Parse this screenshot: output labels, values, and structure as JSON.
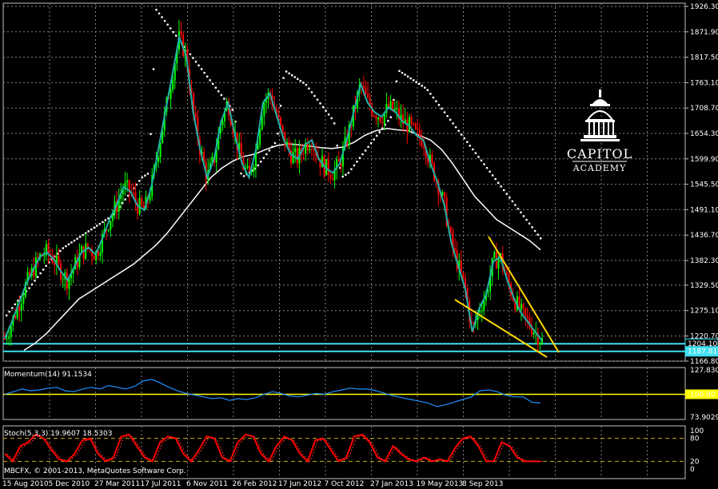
{
  "chart_data": [
    {
      "type": "candlestick",
      "panel": "price",
      "ylim": [
        1166.8,
        1926.3
      ],
      "y_ticks": [
        "1926.30",
        "1871.90",
        "1817.50",
        "1763.10",
        "1708.70",
        "1654.30",
        "1599.90",
        "1545.50",
        "1491.10",
        "1436.70",
        "1382.30",
        "1329.50",
        "1275.10",
        "1220.70",
        "1166.80"
      ],
      "x_ticks": [
        "15 Aug 2010",
        "5 Dec 2010",
        "27 Mar 2011",
        "17 Jul 2011",
        "6 Nov 2011",
        "26 Feb 2012",
        "17 Jun 2012",
        "7 Oct 2012",
        "27 Jan 2013",
        "19 May 2013",
        "8 Sep 2013"
      ],
      "price_series": [
        1215,
        1250,
        1290,
        1330,
        1360,
        1390,
        1400,
        1385,
        1360,
        1340,
        1370,
        1400,
        1410,
        1395,
        1430,
        1470,
        1500,
        1540,
        1530,
        1500,
        1490,
        1540,
        1620,
        1700,
        1780,
        1860,
        1820,
        1700,
        1620,
        1560,
        1600,
        1680,
        1720,
        1650,
        1590,
        1560,
        1620,
        1720,
        1740,
        1690,
        1640,
        1610,
        1600,
        1630,
        1640,
        1600,
        1580,
        1570,
        1590,
        1640,
        1700,
        1760,
        1720,
        1700,
        1690,
        1710,
        1700,
        1680,
        1670,
        1650,
        1640,
        1590,
        1550,
        1500,
        1420,
        1370,
        1320,
        1230,
        1280,
        1310,
        1380,
        1390,
        1340,
        1300,
        1270,
        1250,
        1230,
        1210
      ],
      "moving_average_long": [
        1190,
        1205,
        1225,
        1250,
        1275,
        1300,
        1315,
        1330,
        1345,
        1360,
        1375,
        1395,
        1415,
        1440,
        1470,
        1500,
        1530,
        1560,
        1580,
        1595,
        1605,
        1610,
        1620,
        1628,
        1632,
        1630,
        1627,
        1624,
        1622,
        1625,
        1635,
        1650,
        1660,
        1665,
        1662,
        1660,
        1650,
        1640,
        1620,
        1590,
        1555,
        1520,
        1495,
        1470,
        1455,
        1440,
        1425,
        1405
      ],
      "sar": [
        1265,
        1285,
        1305,
        1320,
        1340,
        1360,
        1380,
        1395,
        1410,
        1420,
        1430,
        1440,
        1450,
        1460,
        1470,
        1480,
        1500,
        1520,
        1540,
        1560,
        1570,
        1920,
        1900,
        1880,
        1860,
        1840,
        1820,
        1800,
        1780,
        1760,
        1740,
        1720,
        1700,
        1560,
        1570,
        1580,
        1600,
        1620,
        1640,
        1790,
        1780,
        1770,
        1760,
        1740,
        1720,
        1700,
        1680,
        1560,
        1570,
        1590,
        1610,
        1630,
        1650,
        1670,
        1690,
        1790,
        1780,
        1770,
        1760,
        1750,
        1730,
        1710,
        1690,
        1670,
        1650,
        1630,
        1610,
        1590,
        1570,
        1550,
        1530,
        1510,
        1490,
        1470,
        1450,
        1430
      ],
      "horizontal_lines": [
        1204.1,
        1187.81
      ],
      "price_labels": [
        "1204.10",
        "1187.81"
      ],
      "colors": {
        "bull": "#00ff00",
        "bear": "#ff0000",
        "ma_short": "#20b2aa",
        "ma_long": "#ffffff",
        "sar": "#ffffff",
        "hline": "#40e0f0",
        "trendline": "#ffd700",
        "grid": "#808080"
      }
    },
    {
      "type": "line",
      "panel": "momentum",
      "label": "Momentum(14) 91.1534",
      "ylim": [
        73.9029,
        127.8301
      ],
      "y_ticks": [
        "127.8301",
        "100.00",
        "73.9029"
      ],
      "level": 100.0,
      "values": [
        100,
        103,
        106,
        104,
        105,
        107,
        108,
        104,
        103,
        106,
        108,
        106,
        110,
        108,
        106,
        109,
        115,
        117,
        113,
        108,
        104,
        101,
        99,
        97,
        95,
        96,
        93,
        95,
        94,
        96,
        100,
        103,
        101,
        98,
        97,
        99,
        101,
        100,
        103,
        105,
        107,
        106,
        106,
        104,
        101,
        98,
        96,
        94,
        92,
        90,
        86,
        88,
        91,
        94,
        97,
        104,
        105,
        103,
        99,
        97,
        97,
        91,
        90
      ]
    },
    {
      "type": "line",
      "panel": "stochastic",
      "label": "Stoch(5,3,3) 19.9607 18.5303",
      "ylim": [
        0,
        100
      ],
      "y_ticks": [
        "100",
        "80",
        "20",
        "0"
      ],
      "levels": [
        80,
        20
      ],
      "values": [
        40,
        20,
        60,
        70,
        90,
        80,
        50,
        25,
        20,
        40,
        75,
        80,
        40,
        20,
        30,
        85,
        90,
        60,
        30,
        20,
        70,
        85,
        80,
        40,
        20,
        50,
        85,
        80,
        30,
        20,
        70,
        90,
        85,
        40,
        20,
        60,
        85,
        75,
        40,
        20,
        75,
        80,
        50,
        20,
        30,
        85,
        90,
        70,
        30,
        20,
        60,
        40,
        25,
        20,
        30,
        20,
        25,
        20,
        55,
        80,
        85,
        60,
        20,
        20,
        70,
        60,
        30,
        20,
        20,
        20
      ]
    }
  ],
  "copyright": "MBCFX, © 2001-2013, MetaQuotes Software Corp.",
  "logo": {
    "line1": "CAPITOL",
    "line2": "ACADEMY"
  }
}
